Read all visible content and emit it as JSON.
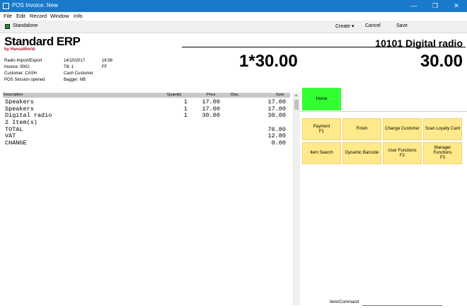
{
  "window": {
    "title": "POS Invoice: New",
    "controls": {
      "minimize": "—",
      "maximize": "❐",
      "close": "✕"
    }
  },
  "menu": [
    "File",
    "Edit",
    "Record",
    "Window",
    "Info"
  ],
  "toolbar": {
    "mode": "Standalone",
    "create": "Create ▾",
    "cancel": "Cancel",
    "save": "Save"
  },
  "brand": {
    "name": "Standard ERP",
    "by": "by HansaWorld"
  },
  "info": {
    "company": "Radio Import/Export",
    "date": "14/10/2017",
    "time": "16:56",
    "invoice": "Invoice: 9002",
    "till": "Till: 1",
    "till_user": "FF",
    "customer": "Customer: CASH",
    "customer_name": "Cash Customer",
    "session": "POS Session opened",
    "bagger": "Bagger: NB"
  },
  "display": {
    "item": "10101 Digital radio",
    "qty_price": "1*30.00",
    "amount": "30.00"
  },
  "table": {
    "headers": {
      "description": "Description",
      "quantity": "Quantity",
      "price": "Price",
      "disc": "Disc.",
      "sum": "Sum"
    },
    "rows": [
      {
        "description": "Speakers",
        "quantity": "1",
        "price": "17.00",
        "sum": "17.00"
      },
      {
        "description": "Speakers",
        "quantity": "1",
        "price": "17.00",
        "sum": "17.00"
      },
      {
        "description": "Digital radio",
        "quantity": "1",
        "price": "30.00",
        "sum": "30.00"
      },
      {
        "description": "2 Item(s)",
        "quantity": "",
        "price": "",
        "sum": ""
      },
      {
        "description": "TOTAL",
        "quantity": "",
        "price": "",
        "sum": "76.80"
      },
      {
        "description": "VAT",
        "quantity": "",
        "price": "",
        "sum": "12.80"
      },
      {
        "description": "CHANGE",
        "quantity": "",
        "price": "",
        "sum": "0.00"
      }
    ]
  },
  "buttons": {
    "home": "Home",
    "payment": "Payment\nF1",
    "finish": "Finish",
    "change_customer": "Change Customer",
    "scan_loyalty": "Scan Loyalty Card",
    "item_search": "Item Search",
    "dynamic_barcode": "Dynamic Barcode",
    "user_functions": "User Functions\nF2",
    "manager_functions": "Manager\nFunctions\nF3"
  },
  "command": {
    "label": "Item/Command",
    "value": ""
  },
  "colors": {
    "titlebar": "#1979ca",
    "home": "#33ff33",
    "fkey": "#ffe98a",
    "brand_by": "#b01c2e"
  }
}
